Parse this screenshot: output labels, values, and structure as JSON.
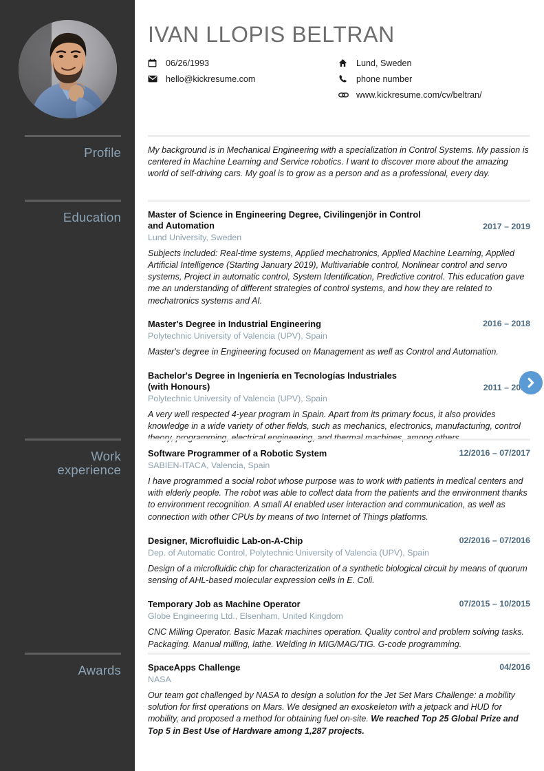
{
  "sidebar": {
    "avatar_alt": "portrait-photo",
    "sections": [
      {
        "label": "Profile"
      },
      {
        "label": "Education"
      },
      {
        "label": "Work experience"
      },
      {
        "label": "Awards"
      }
    ]
  },
  "header": {
    "name": "IVAN LLOPIS BELTRAN",
    "contacts_left": [
      {
        "icon": "calendar-icon",
        "text": "06/26/1993"
      },
      {
        "icon": "envelope-icon",
        "text": "hello@kickresume.com"
      }
    ],
    "contacts_right": [
      {
        "icon": "home-icon",
        "text": "Lund, Sweden"
      },
      {
        "icon": "phone-icon",
        "text": "phone number"
      },
      {
        "icon": "link-icon",
        "text": "www.kickresume.com/cv/beltran/"
      }
    ]
  },
  "profile": {
    "text": "My background is in Mechanical Engineering with a specialization in Control Systems. My passion is centered in Machine Learning and Service robotics. I want to discover more about the amazing world of self-driving cars. My goal is to grow as a person and as a professional, every day."
  },
  "education": [
    {
      "title": "Master of Science in Engineering Degree, Civilingenjör in Control and Automation",
      "date": "2017 – 2019",
      "subtitle": "Lund University, Sweden",
      "description": "Subjects included: Real-time systems, Applied mechatronics, Applied Machine Learning, Applied Artificial Intelligence (Starting January 2019), Multivariable control, Nonlinear control and servo systems, Project in automatic control, System Identification, Predictive control. This education gave me an understanding of different strategies of control systems, and how they are related to mechatronics systems and AI."
    },
    {
      "title": "Master's Degree in Industrial Engineering",
      "date": "2016 – 2018",
      "subtitle": "Polytechnic University of Valencia (UPV), Spain",
      "description": "Master's degree in Engineering focused on Management as well as Control and Automation."
    },
    {
      "title": "Bachelor's Degree in Ingeniería en Tecnologías Industriales (with Honours)",
      "date": "2011 – 2015",
      "subtitle": "Polytechnic University of Valencia (UPV), Spain",
      "description": "A very well respected 4-year program in Spain. Apart from its primary focus, it also provides knowledge in a wide variety of other fields, such as mechanics, electronics, manufacturing, control theory, programming, electrical engineering, and thermal machines, among others."
    }
  ],
  "work_experience": [
    {
      "title": "Software Programmer of a Robotic System",
      "date": "12/2016 – 07/2017",
      "subtitle": "SABIEN-ITACA, Valencia, Spain",
      "description": "I have programmed a social robot whose purpose was to work with patients in medical centers and with elderly people. The robot was able to collect data from the patients and the environment thanks to environment recognition. A small AI enabled user interaction and communication, as well as connection with other CPUs by means of two Internet of Things platforms."
    },
    {
      "title": "Designer, Microfluidic Lab-on-A-Chip",
      "date": "02/2016 – 07/2016",
      "subtitle": "Dep. of Automatic Control, Polytechnic University of Valencia (UPV), Spain",
      "description": "Design of a microfluidic chip for characterization of a synthetic biological circuit by means of quorum sensing of AHL-based molecular expression cells in E. Coli."
    },
    {
      "title": "Temporary Job as Machine Operator",
      "date": "07/2015 – 10/2015",
      "subtitle": "Globe Engineering Ltd., Elsenham, United Kingdom",
      "description": "CNC Milling Operator. Basic Mazak machines operation. Quality control and problem solving tasks. Packaging. Manual milling, lathe. Welding in MIG/MAG/TIG. G-code programming."
    }
  ],
  "awards": [
    {
      "title": "SpaceApps Challenge",
      "date": "04/2016",
      "subtitle": "NASA",
      "description_plain": "Our team got challenged by NASA to design a solution for the Jet Set Mars Challenge: a mobility solution for first operations on Mars. We designed an exoskeleton with a jetpack and HUD for mobility, and proposed a method for obtaining fuel on-site. ",
      "description_bold": "We reached Top 25 Global Prize and Top 5 in Best Use of Hardware among 1,287 projects."
    }
  ],
  "controls": {
    "next_button": "next-page",
    "next_button_color": "#5b9bd5"
  },
  "colors": {
    "sidebar_bg": "#333333",
    "sidebar_label": "#8ba3b5",
    "name": "#6d6d6d",
    "date": "#4d6b80",
    "subtitle": "#8ba0b0",
    "rule": "#efefef"
  }
}
